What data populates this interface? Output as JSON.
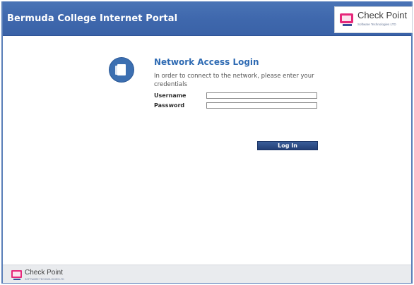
{
  "header": {
    "title": "Bermuda College Internet Portal",
    "brand": {
      "name": "Check Point",
      "subtitle": "Software Technologies LTD",
      "logo_color": "#e6277a",
      "icon": "check-point-logo-icon"
    },
    "bar_color": "#3f68ad"
  },
  "login": {
    "icon": "document-icon",
    "title": "Network Access Login",
    "description": "In order to connect to the network, please enter your credentials",
    "username_label": "Username",
    "username_value": "",
    "password_label": "Password",
    "password_value": "",
    "button_label": "Log In",
    "title_color": "#2f6bb3"
  },
  "footer": {
    "brand": {
      "name": "Check Point",
      "subtitle": "SOFTWARE TECHNOLOGIES LTD",
      "icon": "check-point-logo-icon"
    }
  }
}
